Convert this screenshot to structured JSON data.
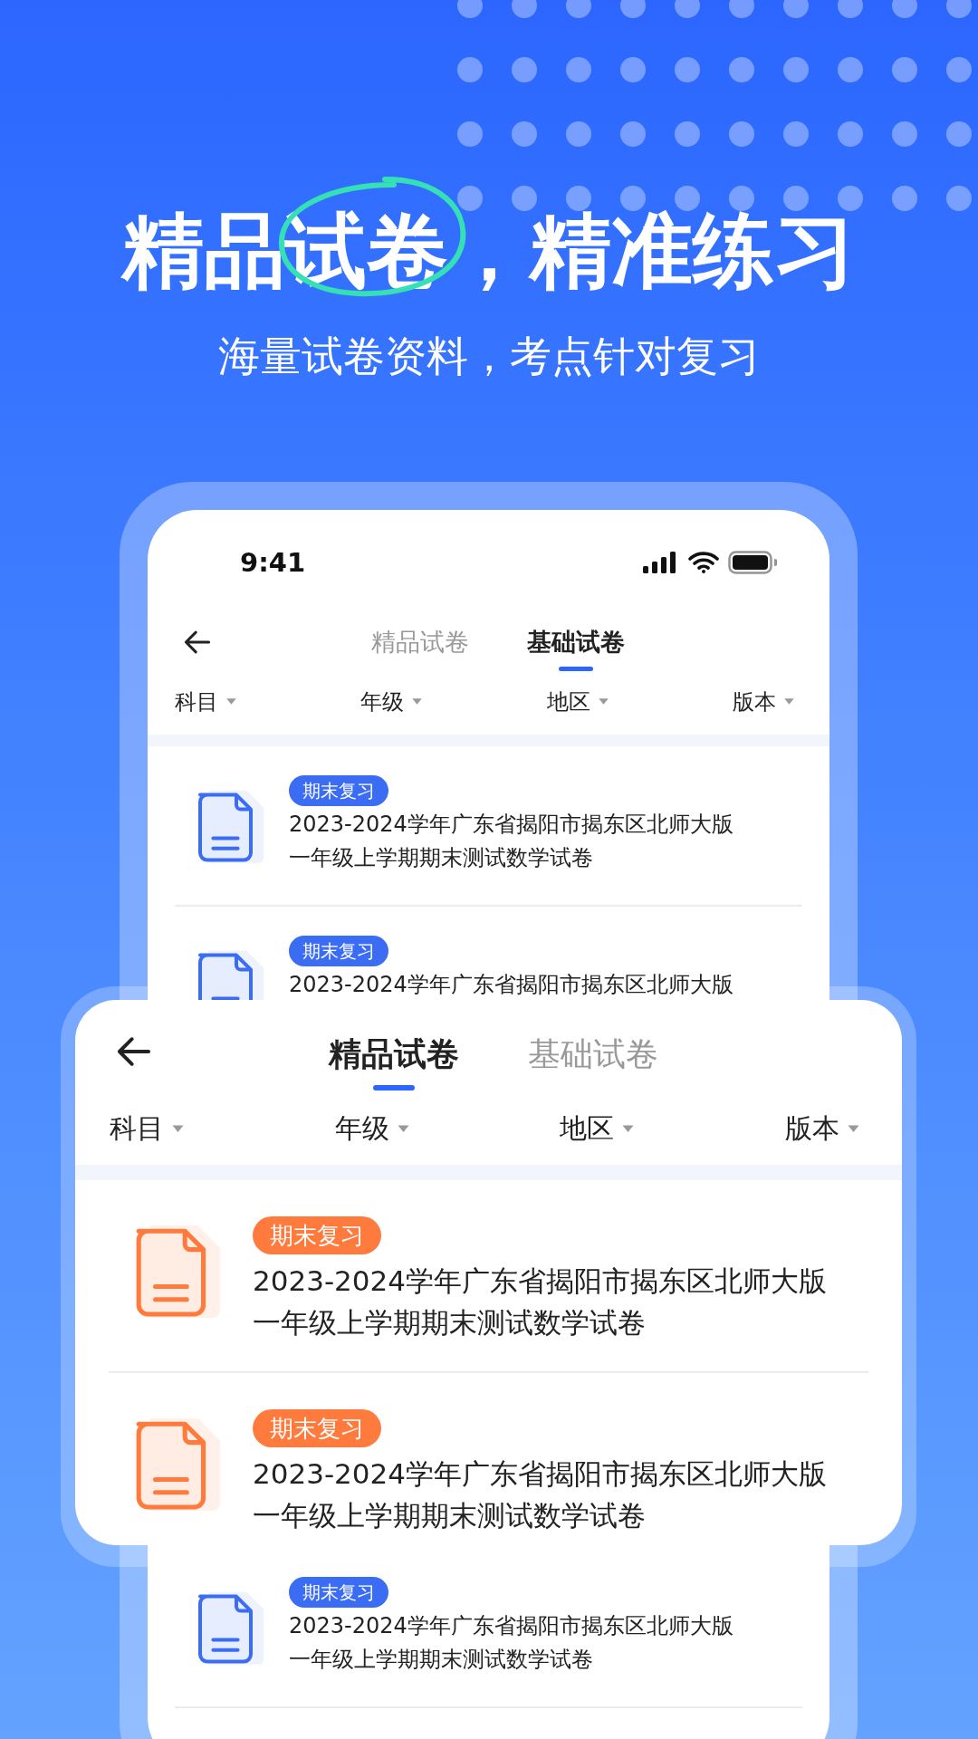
{
  "hero": {
    "title": {
      "before": "精品",
      "circled": "试卷",
      "after": "，精准练习"
    },
    "subtitle": "海量试卷资料，考点针对复习"
  },
  "phone": {
    "status_bar": {
      "time": "9:41"
    },
    "tabs": [
      {
        "label": "精品试卷",
        "selected": false
      },
      {
        "label": "基础试卷",
        "selected": true
      }
    ],
    "filters": [
      "科目",
      "年级",
      "地区",
      "版本"
    ],
    "papers": [
      {
        "tag": "期末复习",
        "lines": [
          "2023-2024学年广东省揭阳市揭东区北师大版",
          "一年级上学期期末测试数学试卷"
        ]
      },
      {
        "tag": "期末复习",
        "lines": [
          "2023-2024学年广东省揭阳市揭东区北师大版"
        ]
      },
      {
        "tag": "期末复习",
        "lines": [
          "2023-2024学年广东省揭阳市揭东区北师大版",
          "一年级上学期期末测试数学试卷"
        ]
      }
    ]
  },
  "overlay_card": {
    "tabs": [
      {
        "label": "精品试卷",
        "selected": true
      },
      {
        "label": "基础试卷",
        "selected": false
      }
    ],
    "filters": [
      "科目",
      "年级",
      "地区",
      "版本"
    ],
    "papers": [
      {
        "tag": "期末复习",
        "lines": [
          "2023-2024学年广东省揭阳市揭东区北师大版",
          "一年级上学期期末测试数学试卷"
        ]
      },
      {
        "tag": "期末复习",
        "lines": [
          "2023-2024学年广东省揭阳市揭东区北师大版",
          "一年级上学期期末测试数学试卷"
        ]
      }
    ]
  }
}
